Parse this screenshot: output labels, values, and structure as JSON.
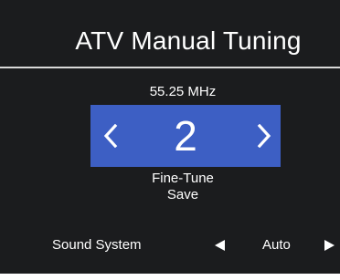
{
  "title": "ATV Manual Tuning",
  "frequency": "55.25 MHz",
  "channel": {
    "number": "2",
    "prev_icon": "chevron-left-icon",
    "next_icon": "chevron-right-icon"
  },
  "options": {
    "fine_tune": "Fine-Tune",
    "save": "Save"
  },
  "sound_system": {
    "label": "Sound System",
    "value": "Auto",
    "prev_icon": "triangle-left-icon",
    "next_icon": "triangle-right-icon"
  },
  "colors": {
    "background": "#1b1c1e",
    "highlight": "#3d5fc4",
    "text": "#ffffff",
    "rule": "#d9d9d9"
  }
}
